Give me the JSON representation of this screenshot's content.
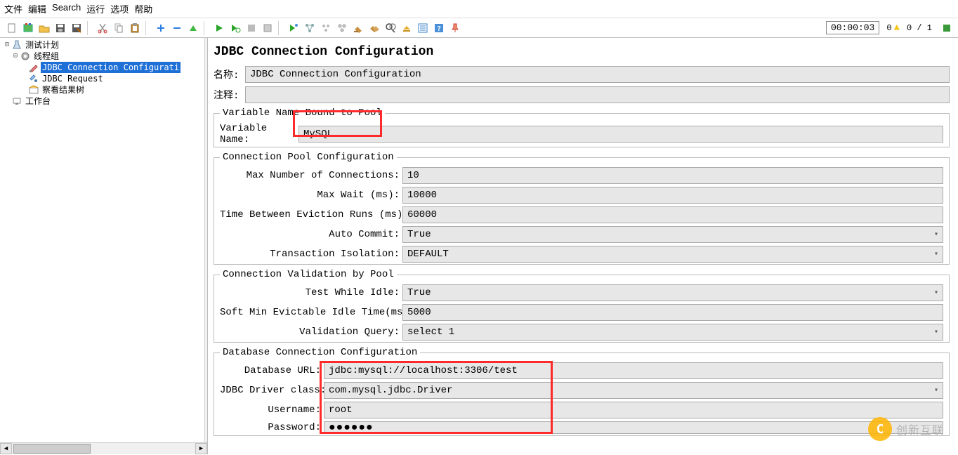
{
  "menu": {
    "file": "文件",
    "edit": "编辑",
    "search": "Search",
    "run": "运行",
    "options": "选项",
    "help": "帮助"
  },
  "status": {
    "timer": "00:00:03",
    "warn": "0",
    "frac": "0 / 1"
  },
  "tree": {
    "root": "测试计划",
    "threadGroup": "线程组",
    "jdbcConn": "JDBC Connection Configurati",
    "jdbcReq": "JDBC Request",
    "viewTree": "察看结果树",
    "workbench": "工作台"
  },
  "page": {
    "title": "JDBC Connection Configuration",
    "nameLabel": "名称:",
    "nameValue": "JDBC Connection Configuration",
    "commentLabel": "注释:",
    "commentValue": ""
  },
  "varPool": {
    "legend": "Variable Name Bound to Pool",
    "label": "Variable Name:",
    "value": "MySQL"
  },
  "connPool": {
    "legend": "Connection Pool Configuration",
    "maxConn": {
      "label": "Max Number of Connections:",
      "value": "10"
    },
    "maxWait": {
      "label": "Max Wait (ms):",
      "value": "10000"
    },
    "evict": {
      "label": "Time Between Eviction Runs (ms):",
      "value": "60000"
    },
    "autoCommit": {
      "label": "Auto Commit:",
      "value": "True"
    },
    "txIso": {
      "label": "Transaction Isolation:",
      "value": "DEFAULT"
    }
  },
  "validation": {
    "legend": "Connection Validation by Pool",
    "testIdle": {
      "label": "Test While Idle:",
      "value": "True"
    },
    "softMin": {
      "label": "Soft Min Evictable Idle Time(ms):",
      "value": "5000"
    },
    "query": {
      "label": "Validation Query:",
      "value": "select 1"
    }
  },
  "db": {
    "legend": "Database Connection Configuration",
    "url": {
      "label": "Database URL:",
      "value": "jdbc:mysql://localhost:3306/test"
    },
    "driver": {
      "label": "JDBC Driver class:",
      "value": "com.mysql.jdbc.Driver"
    },
    "user": {
      "label": "Username:",
      "value": "root"
    },
    "pass": {
      "label": "Password:",
      "value": "●●●●●●"
    }
  },
  "watermark": "创新互联"
}
